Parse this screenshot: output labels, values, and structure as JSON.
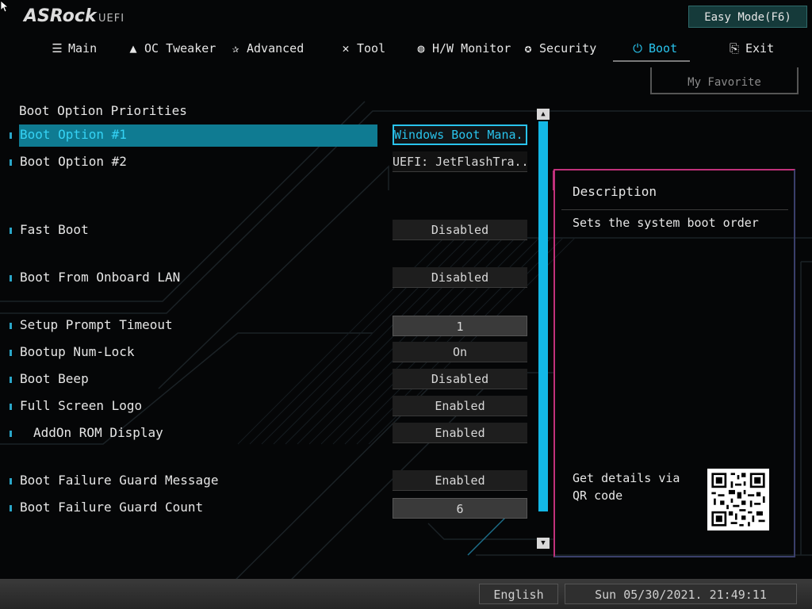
{
  "brand": {
    "logo_text": "ASRock",
    "logo_suffix": "UEFI"
  },
  "easy_mode_label": "Easy Mode(F6)",
  "tabs": [
    {
      "label": "Main",
      "icon": "list-icon",
      "glyph": "☰"
    },
    {
      "label": "OC Tweaker",
      "icon": "rocket-icon",
      "glyph": "🚀"
    },
    {
      "label": "Advanced",
      "icon": "star-icon",
      "glyph": "✰"
    },
    {
      "label": "Tool",
      "icon": "tools-icon",
      "glyph": "✕"
    },
    {
      "label": "H/W Monitor",
      "icon": "monitor-icon",
      "glyph": "◍"
    },
    {
      "label": "Security",
      "icon": "shield-icon",
      "glyph": "✪"
    },
    {
      "label": "Boot",
      "icon": "power-icon",
      "glyph": "⏻"
    },
    {
      "label": "Exit",
      "icon": "exit-icon",
      "glyph": "⎘"
    }
  ],
  "active_tab": "Boot",
  "my_favorite_label": "My Favorite",
  "section_title": "Boot Option Priorities",
  "settings": [
    {
      "label": "Boot Option #1",
      "value": "Windows Boot Mana..."
    },
    {
      "label": "Boot Option #2",
      "value": "UEFI: JetFlashTra..."
    },
    {
      "label": "Fast Boot",
      "value": "Disabled"
    },
    {
      "label": "Boot From Onboard LAN",
      "value": "Disabled"
    },
    {
      "label": "Setup Prompt Timeout",
      "value": "1"
    },
    {
      "label": "Bootup Num-Lock",
      "value": "On"
    },
    {
      "label": "Boot Beep",
      "value": "Disabled"
    },
    {
      "label": "Full Screen Logo",
      "value": "Enabled"
    },
    {
      "label": "AddOn ROM Display",
      "value": "Enabled"
    },
    {
      "label": "Boot Failure Guard Message",
      "value": "Enabled"
    },
    {
      "label": "Boot Failure Guard Count",
      "value": "6"
    }
  ],
  "description": {
    "title": "Description",
    "text": "Sets the system boot order",
    "qr_label": "Get details via QR code"
  },
  "footer": {
    "language": "English",
    "datetime": "Sun 05/30/2021. 21:49:11"
  },
  "colors": {
    "accent": "#29c3ec",
    "highlight": "#0f7b92",
    "scrollbar": "#13b8e6",
    "panel_border": "#c0317a"
  }
}
